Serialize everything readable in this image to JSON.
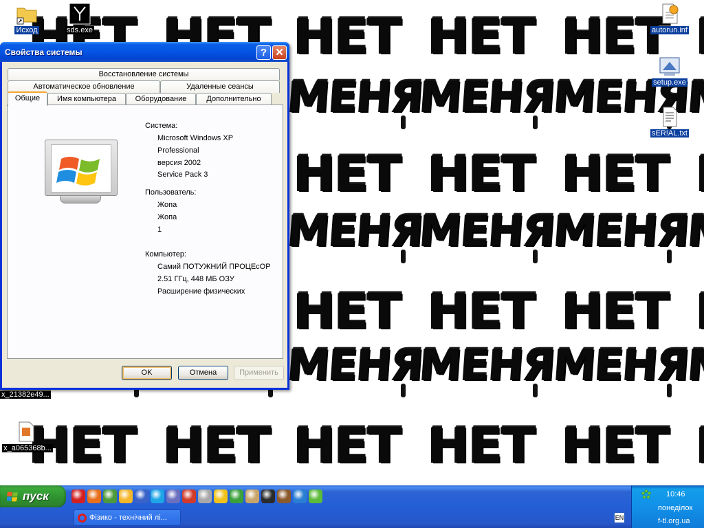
{
  "desktop": {
    "wallpaper_words": [
      "НЕТ",
      "МЕНЯ"
    ],
    "icons": [
      {
        "label": "Исход",
        "icon": "folder-shortcut-icon"
      },
      {
        "label": "sds.exe",
        "icon": "app-icon"
      },
      {
        "label": "autorun.inf",
        "icon": "settings-file-icon"
      },
      {
        "label": "setup.exe",
        "icon": "setup-icon"
      },
      {
        "label": "sER!AL.txt",
        "icon": "text-file-icon"
      },
      {
        "label": "x_21382e49...",
        "icon": "file-icon"
      },
      {
        "label": "x_a065368b...",
        "icon": "media-file-icon"
      }
    ]
  },
  "dialog": {
    "title": "Свойства системы",
    "tabs_row1": [
      "Восстановление системы"
    ],
    "tabs_row2": [
      "Автоматическое обновление",
      "Удаленные сеансы"
    ],
    "tabs_row3": [
      "Общие",
      "Имя компьютера",
      "Оборудование",
      "Дополнительно"
    ],
    "active_tab": "Общие",
    "system_label": "Система:",
    "system_lines": [
      "Microsoft Windows XP",
      "Professional",
      "версия 2002",
      "Service Pack 3"
    ],
    "user_label": "Пользователь:",
    "user_lines": [
      "Жопа",
      "Жопа",
      "1"
    ],
    "computer_label": "Компьютер:",
    "computer_lines": [
      "Самий ПОТУЖНИЙ ПРОЦЕсОР",
      "2.51 ГГц, 448 МБ ОЗУ",
      "Расширение физических"
    ],
    "buttons": {
      "ok": "OK",
      "cancel": "Отмена",
      "apply": "Применить"
    }
  },
  "taskbar": {
    "start_label": "пуск",
    "quicklaunch_icons": [
      "opera-icon",
      "firefox-icon",
      "7zip-icon",
      "pizza-icon",
      "crossfire-icon",
      "skype-icon",
      "chart-icon",
      "apple-icon",
      "cup-icon",
      "emoticon-icon",
      "network-icon",
      "figure-icon",
      "counter-strike-icon",
      "character-icon",
      "ie-icon",
      "asterisk-icon"
    ],
    "task_item": "Фізико - технічний лі...",
    "language": "EN",
    "time": "10:46",
    "day": "понеділок",
    "brand": "f-tl.org.ua"
  },
  "colors": {
    "titlebar": "#0454e3",
    "start_green": "#3aa93a",
    "taskbar_blue": "#245ed6",
    "tray_blue": "#1290e8",
    "dialog_face": "#ece9d8"
  }
}
